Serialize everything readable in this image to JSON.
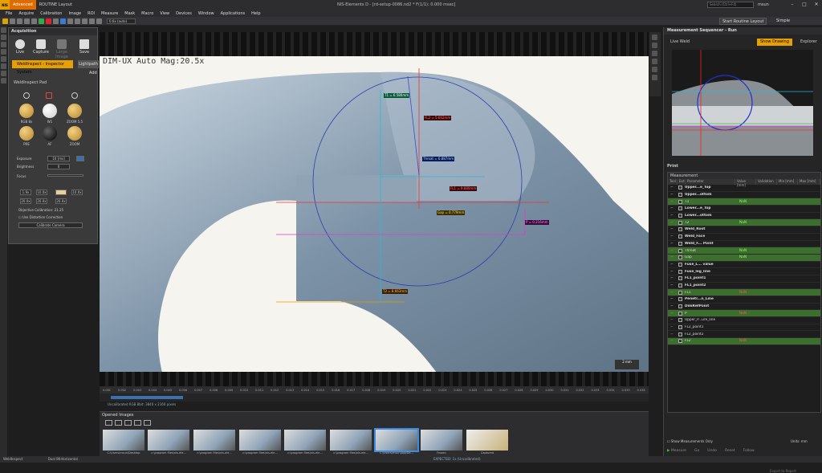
{
  "titlebar": {
    "logo": "NIS",
    "tabs": [
      "Advanced",
      "ROUTINE Layout"
    ],
    "window_title": "NIS-Elements D - [rd-setup-0086.nd2 * F(1/1): 0.000 msec]",
    "search_placeholder": "Search (Ctrl+F4)",
    "user": "msun",
    "routine_layout_label": "Start Routine Layout",
    "simple_label": "Simple"
  },
  "menu": [
    "File",
    "Acquire",
    "Calibration",
    "Image",
    "ROI",
    "Measure",
    "Mask",
    "Macro",
    "View",
    "Devices",
    "Window",
    "Applications",
    "Help"
  ],
  "toolbar": {
    "zoom": "0.6x (auto)"
  },
  "acquisition": {
    "title": "Acquisition",
    "buttons": [
      "Live",
      "Capture",
      "Large Image",
      "Save"
    ],
    "weldinspect_tab": "WeldInspect - Inspector System",
    "lightpath_tab": "Lightpath",
    "add_label": "Add",
    "pad_label": "WeldInspect Pad",
    "pads": [
      {
        "label": "RGB 8x"
      },
      {
        "label": "W1"
      },
      {
        "label": "ZOOM 5.5"
      },
      {
        "label": "PRE"
      },
      {
        "label": "AF"
      },
      {
        "label": "ZOOM"
      }
    ],
    "exposure_label": "Exposure",
    "exposure_value": "10 [ms]",
    "brightness_label": "Brightness",
    "brightness_value": "0",
    "focus_label": "Focus",
    "zoom_buttons": [
      "1.9x",
      "10.0x",
      "10.0x",
      "20.0x",
      "20.0x",
      "20.0x"
    ],
    "objective_calibration": "Objective Calibration: 21.25",
    "distortion_label": "Use Distortion Correction",
    "calibrate_label": "Calibrate Camera"
  },
  "image": {
    "overlay_text": "DIM-UX Auto  Mag:20.5x",
    "scale_bar": "2 mm",
    "labels": [
      {
        "id": "t1",
        "text": "T1 = 6.580mm"
      },
      {
        "id": "fl2",
        "text": "FL2 = 5.662mm"
      },
      {
        "id": "throat",
        "text": "Throat = 6.887mm"
      },
      {
        "id": "fl1",
        "text": "FL1 = 9.880mm"
      },
      {
        "id": "gap",
        "text": "Gap = 0.779mm"
      },
      {
        "id": "p",
        "text": "P = 0.216mm"
      },
      {
        "id": "t2",
        "text": "T2 = 8.663mm"
      }
    ]
  },
  "ruler_ticks": [
    "0.001",
    "0.002",
    "0.003",
    "0.004",
    "0.005",
    "0.006",
    "0.007",
    "0.008",
    "0.009",
    "0.010",
    "0.011",
    "0.012",
    "0.013",
    "0.014",
    "0.015",
    "0.016",
    "0.017",
    "0.018",
    "0.019",
    "0.020",
    "0.021",
    "0.022",
    "0.023",
    "0.024",
    "0.025",
    "0.026",
    "0.027",
    "0.028",
    "0.029",
    "0.030",
    "0.031",
    "0.032",
    "0.033",
    "0.034",
    "0.035",
    "0.036"
  ],
  "image_status": "Uncalibrated  RGB 8bit: 3840 x 2160 pixels",
  "opened_images": {
    "title": "Opened Images",
    "thumbs": [
      "C:\\Users\\msun\\Desktop",
      "c:\\program files\\nis-ele...",
      "c:\\program files\\nis-ele...",
      "c:\\program files\\nis-ele...",
      "c:\\program files\\nis-ele...",
      "c:\\program files\\nis-ele...",
      "C:\\Users\\msun\\AppDa...",
      "Frozen",
      "Captured"
    ]
  },
  "sequencer": {
    "title": "Measurement Sequencer - Run",
    "mode": "Live Weld",
    "show_drawing": "Show Drawing",
    "explorer": "Explorer",
    "print_label": "Print",
    "table_title": "Measurement",
    "columns": [
      "Tool",
      "Ext",
      "Parameter",
      "Value [mm]",
      "Validation",
      "Min [mm]",
      "Max [mm]"
    ],
    "rows": [
      {
        "name": "Upper...e_Top",
        "value": "",
        "style": "section"
      },
      {
        "name": "Upper...ottom",
        "value": "",
        "style": "section"
      },
      {
        "name": "T1",
        "value": "NaN",
        "style": "green"
      },
      {
        "name": "Lower...e_Top",
        "value": "",
        "style": "section"
      },
      {
        "name": "Lower...ottom",
        "value": "",
        "style": "section"
      },
      {
        "name": "T2",
        "value": "NaN",
        "style": "green"
      },
      {
        "name": "Weld_Root",
        "value": "",
        "style": "section"
      },
      {
        "name": "Weld_Face",
        "value": "",
        "style": "section"
      },
      {
        "name": "Weld_F... Point",
        "value": "",
        "style": "section"
      },
      {
        "name": "Throat",
        "value": "NaN",
        "style": "green"
      },
      {
        "name": "Gap",
        "value": "NaN",
        "style": "green"
      },
      {
        "name": "Fuse_L... value",
        "value": "",
        "style": "section"
      },
      {
        "name": "Fuse_leg_line",
        "value": "",
        "style": "section"
      },
      {
        "name": "FL1_point1",
        "value": "",
        "style": "section"
      },
      {
        "name": "FL1_point2",
        "value": "",
        "style": "section"
      },
      {
        "name": "FL1",
        "value": "NaN",
        "style": "green-red"
      },
      {
        "name": "Penetr...n_Line",
        "value": "",
        "style": "section"
      },
      {
        "name": "DimRefPoint",
        "value": "",
        "style": "section"
      },
      {
        "name": "P",
        "value": "NaN",
        "style": "green-red"
      },
      {
        "name": "Upper_P...ure_line",
        "value": "",
        "style": "plain"
      },
      {
        "name": "FL2_point1",
        "value": "",
        "style": "plain"
      },
      {
        "name": "FL2_point2",
        "value": "",
        "style": "plain"
      },
      {
        "name": "FL2",
        "value": "NaN",
        "style": "green-red"
      }
    ],
    "filter_label": "Show Measurements Only",
    "units_label": "Units:",
    "units_value": "mm",
    "run_buttons": [
      "Measure",
      "Go",
      "Undo",
      "Reset",
      "Follow"
    ],
    "result_label": "Result",
    "export_label": "Export to Report"
  },
  "statusbar": {
    "left": "WeldInspect",
    "left2": "Dual 8K-Horizontal",
    "mid": "EXPECTED: 1x (Uncalibrated)"
  },
  "colors": {
    "accent": "#e8a000",
    "green_row": "#3c6e2e",
    "selection": "#3b8be0"
  }
}
